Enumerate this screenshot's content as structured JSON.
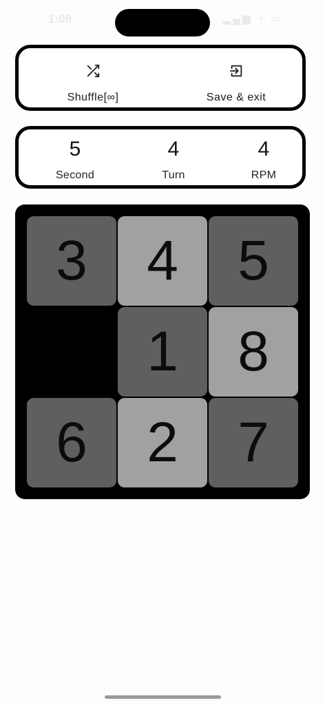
{
  "status_bar": {
    "time": "1:09",
    "icons": "▂▄▆ ◔ ▭"
  },
  "actions": {
    "shuffle": {
      "label": "Shuffle[∞]",
      "icon": "shuffle-icon"
    },
    "save_exit": {
      "label": "Save & exit",
      "icon": "exit-icon"
    }
  },
  "stats": [
    {
      "value": "5",
      "label": "Second"
    },
    {
      "value": "4",
      "label": "Turn"
    },
    {
      "value": "4",
      "label": "RPM"
    }
  ],
  "board": {
    "grid_size": 3,
    "tiles": [
      {
        "number": "3",
        "shade": "dark"
      },
      {
        "number": "4",
        "shade": "light"
      },
      {
        "number": "5",
        "shade": "dark"
      },
      {
        "number": "",
        "shade": "empty"
      },
      {
        "number": "1",
        "shade": "dark"
      },
      {
        "number": "8",
        "shade": "light"
      },
      {
        "number": "6",
        "shade": "dark"
      },
      {
        "number": "2",
        "shade": "light"
      },
      {
        "number": "7",
        "shade": "dark"
      }
    ]
  },
  "colors": {
    "tile_dark": "#5f5f5f",
    "tile_light": "#a1a1a1",
    "board_background": "#000000"
  }
}
